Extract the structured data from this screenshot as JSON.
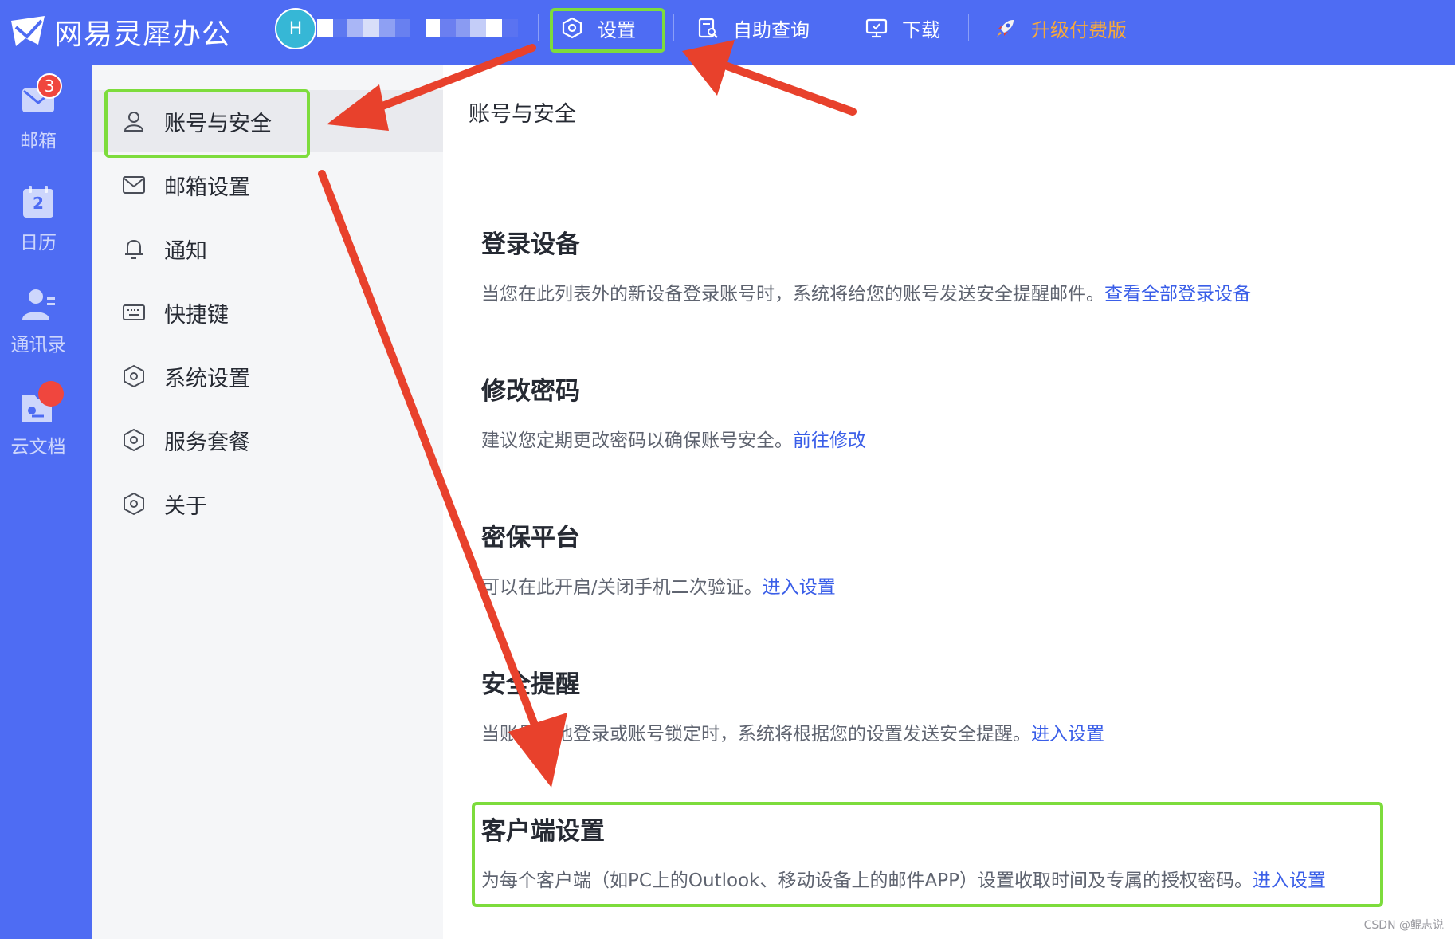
{
  "app": {
    "brand": "网易灵犀办公",
    "avatar_letter": "H",
    "colors": {
      "primary": "#4e6cf3",
      "accent": "#f7a93b",
      "link": "#3a5ee8",
      "highlight": "#7ddc3c",
      "annotation": "#e8412c"
    }
  },
  "topnav": {
    "items": [
      {
        "label": "设置",
        "icon": "hexagon-gear-icon"
      },
      {
        "label": "自助查询",
        "icon": "search-document-icon"
      },
      {
        "label": "下载",
        "icon": "monitor-download-icon"
      },
      {
        "label": "升级付费版",
        "icon": "rocket-icon"
      }
    ]
  },
  "rail": {
    "items": [
      {
        "label": "邮箱",
        "icon": "mail-icon",
        "badge": "3"
      },
      {
        "label": "日历",
        "icon": "calendar-icon",
        "day": "2"
      },
      {
        "label": "通讯录",
        "icon": "contacts-icon"
      },
      {
        "label": "云文档",
        "icon": "cloud-doc-icon"
      }
    ]
  },
  "menu": {
    "items": [
      {
        "label": "账号与安全",
        "icon": "user-icon"
      },
      {
        "label": "邮箱设置",
        "icon": "envelope-icon"
      },
      {
        "label": "通知",
        "icon": "bell-icon"
      },
      {
        "label": "快捷键",
        "icon": "keyboard-icon"
      },
      {
        "label": "系统设置",
        "icon": "hexagon-gear-icon"
      },
      {
        "label": "服务套餐",
        "icon": "hexagon-gear-icon"
      },
      {
        "label": "关于",
        "icon": "hexagon-gear-icon"
      }
    ]
  },
  "content": {
    "title": "账号与安全",
    "sections": [
      {
        "title": "登录设备",
        "desc": "当您在此列表外的新设备登录账号时，系统将给您的账号发送安全提醒邮件。",
        "link": "查看全部登录设备"
      },
      {
        "title": "修改密码",
        "desc": "建议您定期更改密码以确保账号安全。",
        "link": "前往修改"
      },
      {
        "title": "密保平台",
        "desc": "可以在此开启/关闭手机二次验证。",
        "link": "进入设置"
      },
      {
        "title": "安全提醒",
        "desc": "当账号异地登录或账号锁定时，系统将根据您的设置发送安全提醒。",
        "link": "进入设置"
      },
      {
        "title": "客户端设置",
        "desc": "为每个客户端（如PC上的Outlook、移动设备上的邮件APP）设置收取时间及专属的授权密码。",
        "link": "进入设置"
      }
    ]
  },
  "watermark": "CSDN @鲲志说"
}
